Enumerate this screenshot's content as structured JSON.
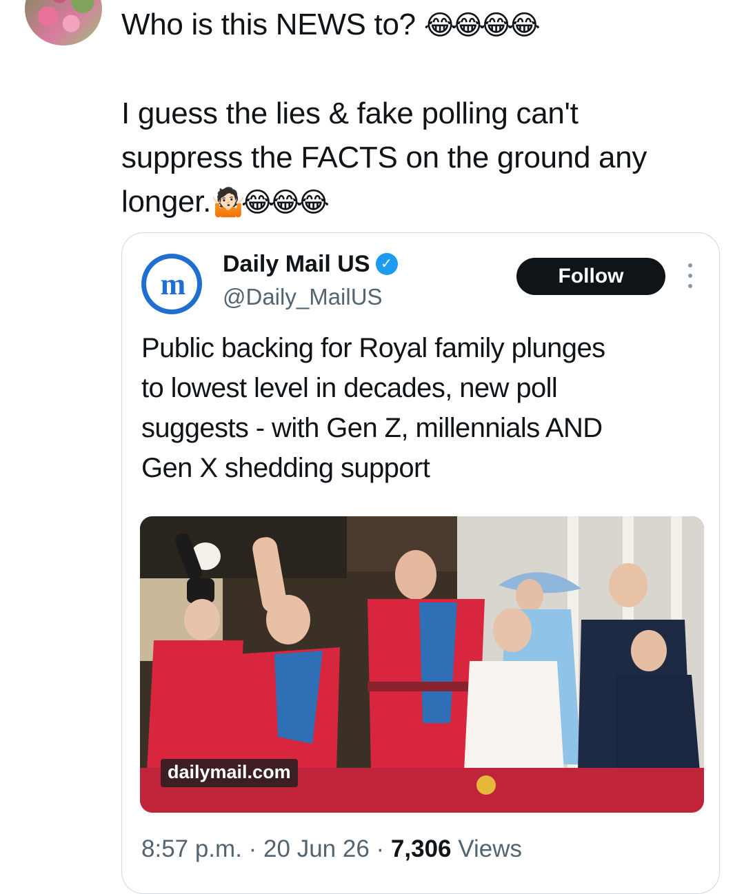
{
  "tweet": {
    "lines": [
      "Who is this NEWS to?",
      "I guess the lies & fake polling can't",
      "suppress the FACTS on the ground any",
      "longer."
    ],
    "emoji_line1": "😂😂😂😂",
    "emoji_line4": "🤷🏻😂😂😂"
  },
  "quote": {
    "avatar_glyph": "m",
    "name": "Daily Mail US",
    "verified_mark": "✓",
    "handle": "@Daily_MailUS",
    "follow_label": "Follow",
    "headline_lines": [
      "Public backing for Royal family plunges",
      "to lowest level in decades, new poll",
      "suggests - with Gen Z, millennials AND",
      "Gen X shedding support"
    ],
    "image_source": "dailymail.com",
    "time": "8:57 p.m.",
    "date": "20 Jun 26",
    "views_count": "7,306",
    "views_label": "Views"
  }
}
